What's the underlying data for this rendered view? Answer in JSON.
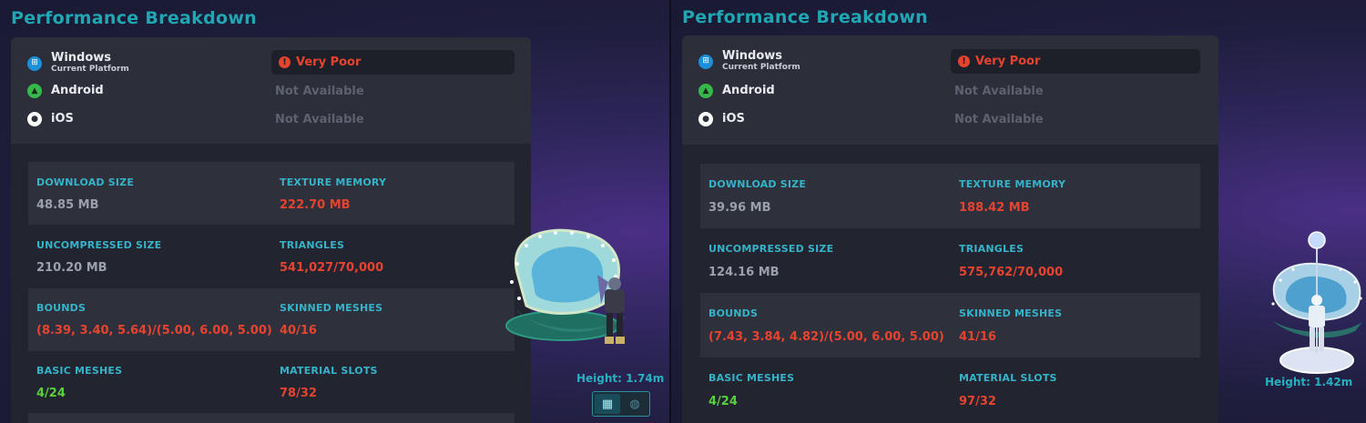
{
  "panels": [
    {
      "title": "Performance Breakdown",
      "platforms": [
        {
          "name": "Windows",
          "sub": "Current Platform",
          "icon": "windows-icon",
          "status": "Very Poor"
        },
        {
          "name": "Android",
          "sub": "",
          "icon": "android-icon",
          "status": "Not Available"
        },
        {
          "name": "iOS",
          "sub": "",
          "icon": "apple-icon",
          "status": "Not Available"
        }
      ],
      "stats": [
        {
          "label": "DOWNLOAD SIZE",
          "value": "48.85 MB"
        },
        {
          "label": "TEXTURE MEMORY",
          "value": "222.70 MB"
        },
        {
          "label": "UNCOMPRESSED SIZE",
          "value": "210.20 MB"
        },
        {
          "label": "TRIANGLES",
          "value": "541,027/70,000"
        },
        {
          "label": "BOUNDS",
          "value": "(8.39, 3.40, 5.64)/(5.00, 6.00, 5.00)"
        },
        {
          "label": "SKINNED MESHES",
          "value": "40/16"
        },
        {
          "label": "BASIC MESHES",
          "value": "4/24"
        },
        {
          "label": "MATERIAL SLOTS",
          "value": "78/32"
        }
      ],
      "height_label": "Height: 1.74m"
    },
    {
      "title": "Performance Breakdown",
      "platforms": [
        {
          "name": "Windows",
          "sub": "Current Platform",
          "icon": "windows-icon",
          "status": "Very Poor"
        },
        {
          "name": "Android",
          "sub": "",
          "icon": "android-icon",
          "status": "Not Available"
        },
        {
          "name": "iOS",
          "sub": "",
          "icon": "apple-icon",
          "status": "Not Available"
        }
      ],
      "stats": [
        {
          "label": "DOWNLOAD SIZE",
          "value": "39.96 MB"
        },
        {
          "label": "TEXTURE MEMORY",
          "value": "188.42 MB"
        },
        {
          "label": "UNCOMPRESSED SIZE",
          "value": "124.16 MB"
        },
        {
          "label": "TRIANGLES",
          "value": "575,762/70,000"
        },
        {
          "label": "BOUNDS",
          "value": "(7.43, 3.84, 4.82)/(5.00, 6.00, 5.00)"
        },
        {
          "label": "SKINNED MESHES",
          "value": "41/16"
        },
        {
          "label": "BASIC MESHES",
          "value": "4/24"
        },
        {
          "label": "MATERIAL SLOTS",
          "value": "97/32"
        }
      ],
      "height_label": "Height: 1.42m"
    }
  ],
  "view_toggle": {
    "icons": [
      "avatar-view-icon",
      "globe-icon"
    ],
    "active": "avatar-view-icon"
  },
  "colors": {
    "accent": "#1fa7b3",
    "stat_label": "#35b3c9",
    "bad": "#e8432f",
    "good": "#59d13e",
    "neutral": "#9ba0ad",
    "unavailable": "#5d6170"
  }
}
